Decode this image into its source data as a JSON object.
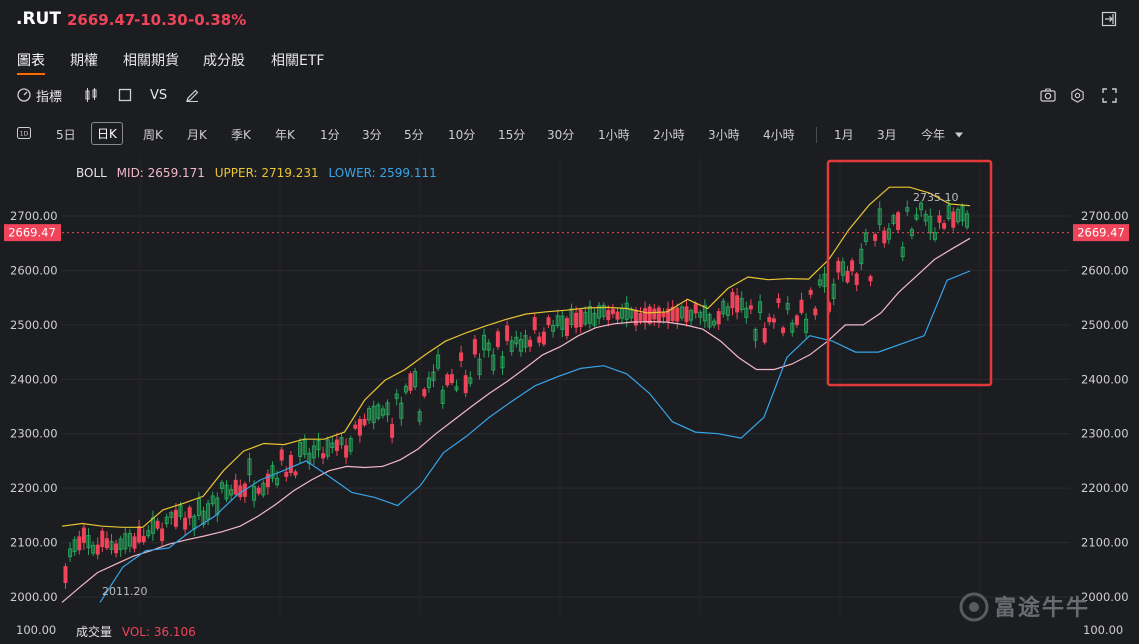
{
  "header": {
    "symbol": ".RUT",
    "price": "2669.47",
    "change": "-10.30",
    "change_pct": "-0.38%"
  },
  "tabs": [
    "圖表",
    "期權",
    "相關期貨",
    "成分股",
    "相關ETF"
  ],
  "toolbar": {
    "indicator_label": "指標",
    "vs_label": "VS"
  },
  "periods": [
    "5日",
    "日K",
    "周K",
    "月K",
    "季K",
    "年K",
    "1分",
    "3分",
    "5分",
    "10分",
    "15分",
    "30分",
    "1小時",
    "2小時",
    "3小時",
    "4小時",
    "1月",
    "3月",
    "今年"
  ],
  "active_period": "日K",
  "boll": {
    "name": "BOLL",
    "mid": "MID: 2659.171",
    "upper": "UPPER: 2719.231",
    "lower": "LOWER: 2599.111"
  },
  "volume": {
    "name": "成交量",
    "vol": "VOL: 36.106"
  },
  "watermark": "富途牛牛",
  "colors": {
    "up": "#27a35a",
    "down": "#ef4459",
    "mid": "#f4b8c8",
    "upper": "#e8c531",
    "lower": "#36a5e8",
    "accent": "#ff6a00",
    "highlight_box": "#e23a3a"
  },
  "chart_data": {
    "type": "candlestick",
    "y_axis_ticks": [
      "2700.00",
      "2600.00",
      "2500.00",
      "2400.00",
      "2300.00",
      "2200.00",
      "2100.00",
      "2000.00"
    ],
    "ylim": [
      1950,
      2770
    ],
    "last_price_label": "2669.47",
    "annotations": [
      {
        "label": "2011.20",
        "value": 2011.2
      },
      {
        "label": "2735.10",
        "value": 2735.1
      }
    ],
    "volume_axis_label": "100.00",
    "series": [
      {
        "name": "MID",
        "values": [
          1990,
          2018,
          2045,
          2060,
          2075,
          2085,
          2097,
          2105,
          2112,
          2120,
          2130,
          2148,
          2170,
          2195,
          2215,
          2232,
          2240,
          2238,
          2240,
          2252,
          2272,
          2300,
          2325,
          2350,
          2374,
          2396,
          2420,
          2445,
          2460,
          2480,
          2495,
          2502,
          2505,
          2506,
          2505,
          2500,
          2492,
          2470,
          2440,
          2418,
          2418,
          2428,
          2445,
          2470,
          2500,
          2500,
          2522,
          2560,
          2590,
          2620,
          2640,
          2659
        ]
      },
      {
        "name": "UPPER",
        "values": [
          2130,
          2135,
          2130,
          2128,
          2128,
          2160,
          2172,
          2185,
          2232,
          2268,
          2282,
          2280,
          2290,
          2290,
          2303,
          2362,
          2398,
          2418,
          2445,
          2470,
          2485,
          2498,
          2510,
          2520,
          2524,
          2527,
          2531,
          2532,
          2530,
          2522,
          2524,
          2547,
          2530,
          2567,
          2588,
          2583,
          2585,
          2584,
          2620,
          2675,
          2720,
          2753,
          2753,
          2742,
          2722,
          2719
        ]
      },
      {
        "name": "LOWER",
        "values": [
          1990,
          2055,
          2085,
          2090,
          2122,
          2148,
          2188,
          2215,
          2232,
          2250,
          2222,
          2192,
          2183,
          2168,
          2205,
          2265,
          2295,
          2330,
          2360,
          2388,
          2405,
          2420,
          2425,
          2410,
          2374,
          2322,
          2303,
          2300,
          2292,
          2330,
          2440,
          2480,
          2470,
          2450,
          2450,
          2465,
          2480,
          2582,
          2599
        ]
      }
    ]
  }
}
